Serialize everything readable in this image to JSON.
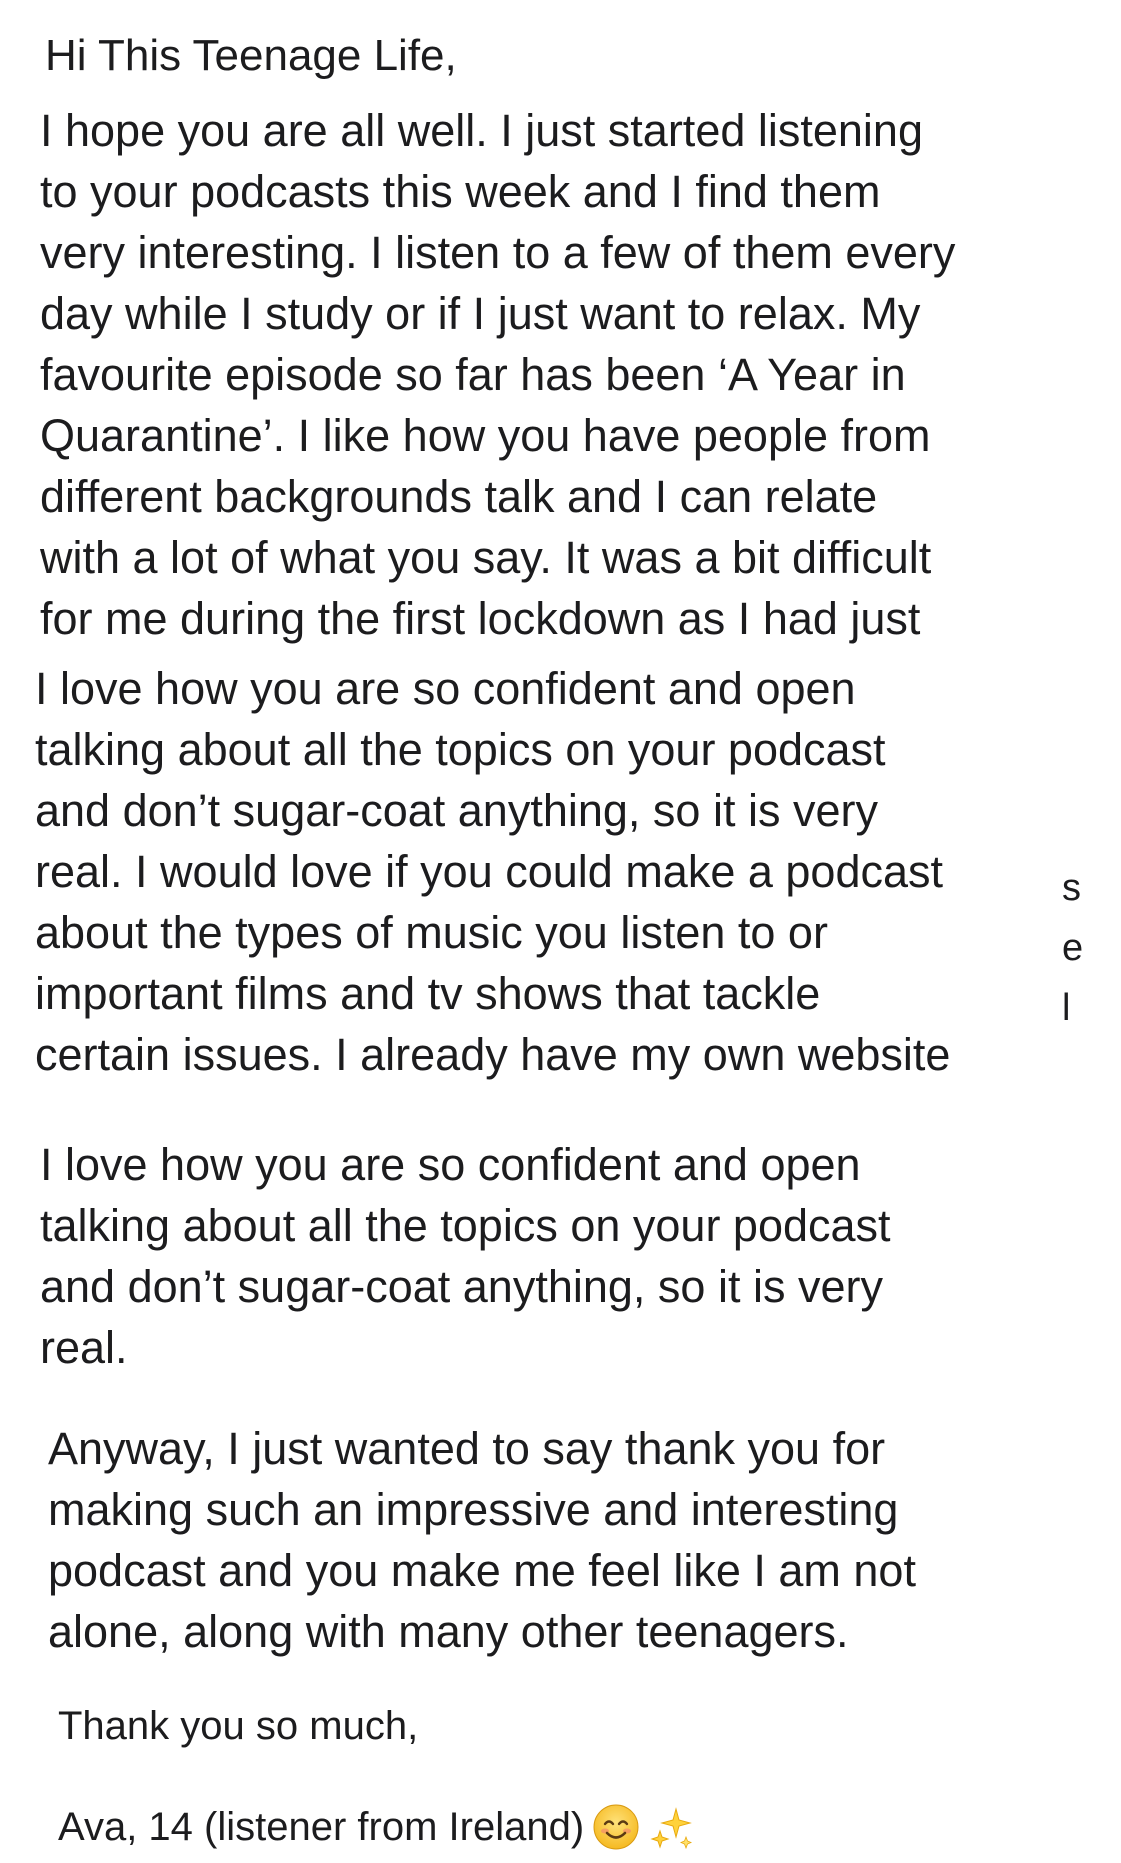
{
  "greeting": "Hi This Teenage Life,",
  "paragraphs": {
    "intro": "I hope you are all well. I just started listening\nto your podcasts this week and I find them\nvery interesting. I listen to a few of them every\nday while I study or if I just want to relax. My\nfavourite episode so far has been ‘A Year in\nQuarantine’. I like how you have people from\ndifferent backgrounds talk and I can relate\nwith a lot of what you say. It was a bit difficult\nfor me during the first lockdown as I had just",
    "overlap": "I love how you are so confident and open\ntalking about all the topics on your podcast\nand don’t sugar-coat anything, so it is very\nreal. I would love if you could make a podcast\nabout the types of music you listen to or\nimportant films and tv shows that tackle\ncertain issues. I already have my own website",
    "repeat": "I love how you are so confident and open\ntalking about all the topics on your podcast\nand don’t sugar-coat anything, so it is very\nreal.",
    "closing": "Anyway, I just wanted to say thank you for\nmaking such an impressive and interesting\npodcast and you make me feel like I am not\nalone, along with many other teenagers."
  },
  "edge_fragments": [
    "s",
    "e",
    "l"
  ],
  "signoff": "Thank you so much,",
  "signature": {
    "text": "Ava, 14 (listener from Ireland)",
    "emoji": [
      "smiling-face-icon",
      "sparkles-icon"
    ]
  }
}
